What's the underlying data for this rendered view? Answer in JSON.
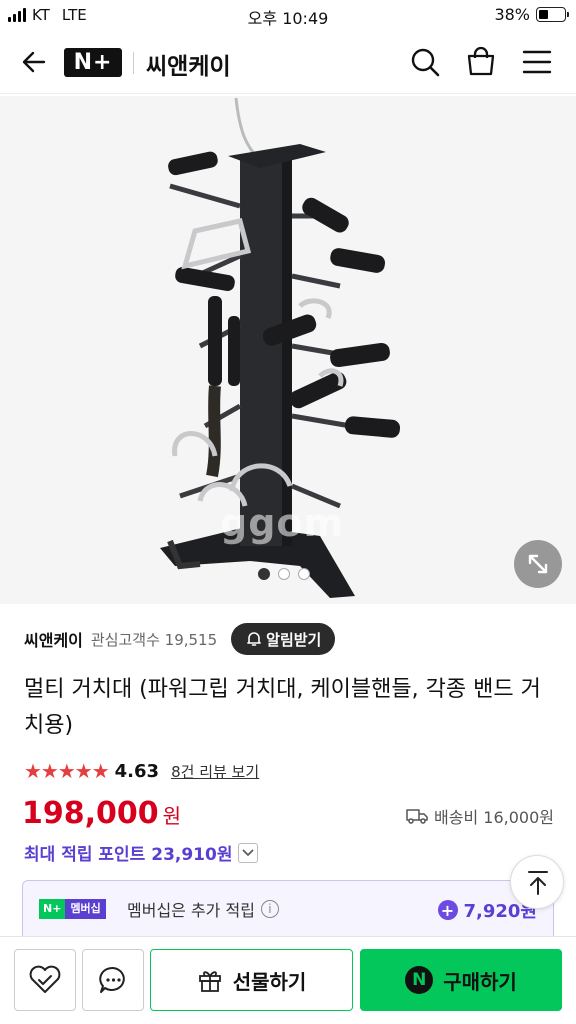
{
  "status": {
    "carrier": "KT",
    "network": "LTE",
    "time": "오후 10:49",
    "battery": "38%"
  },
  "header": {
    "logo": "N+",
    "store_name": "씨앤케이"
  },
  "gallery": {
    "watermark": "ggom",
    "page_count": 3,
    "active_index": 0
  },
  "store": {
    "name": "씨앤케이",
    "followers": "관심고객수 19,515",
    "notify_label": "알림받기"
  },
  "product": {
    "title": "멀티 거치대 (파워그립 거치대, 케이블핸들, 각종 밴드 거치용)",
    "rating": "4.63",
    "stars": "★★★★★",
    "reviews_link": "8건 리뷰 보기",
    "price": "198,000",
    "currency": "원",
    "shipping": "배송비 16,000원",
    "max_points": "최대 적립 포인트 23,910원"
  },
  "membership": {
    "badge_left": "N+",
    "badge_right": "멤버십",
    "text": "멤버십은 추가 적립",
    "info": "i",
    "points": "7,920원"
  },
  "bottom": {
    "gift_label": "선물하기",
    "buy_label": "구매하기",
    "buy_logo": "N"
  },
  "colors": {
    "accent_green": "#03c75a",
    "price_red": "#d6001c",
    "point_purple": "#5b3fd1"
  }
}
